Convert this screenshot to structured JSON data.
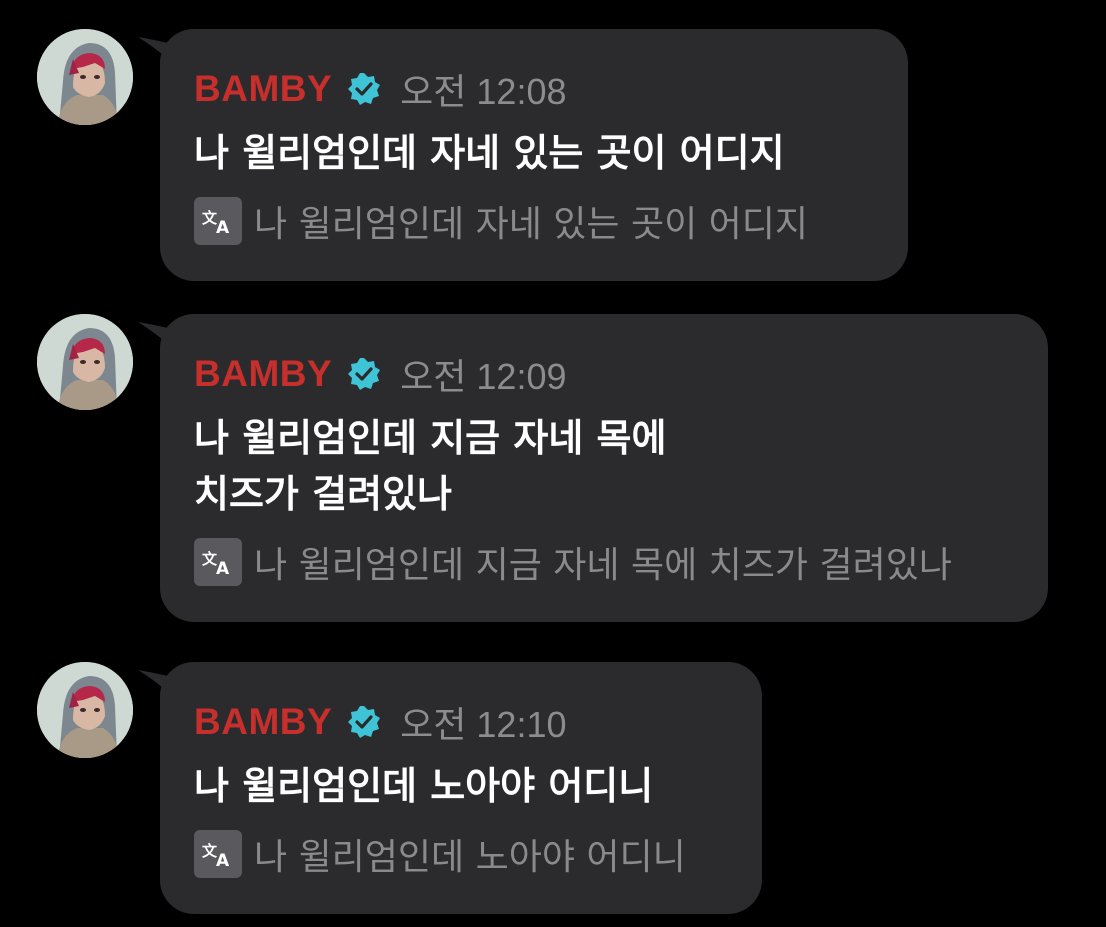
{
  "messages": [
    {
      "author": "BAMBY",
      "verified": true,
      "time": "오전 12:08",
      "text": "나 윌리엄인데 자네 있는 곳이 어디지",
      "translation": "나 윌리엄인데 자네 있는 곳이 어디지"
    },
    {
      "author": "BAMBY",
      "verified": true,
      "time": "오전 12:09",
      "text": "나 윌리엄인데 지금 자네 목에\n치즈가 걸려있나",
      "translation": "나 윌리엄인데 지금 자네 목에 치즈가 걸려있나"
    },
    {
      "author": "BAMBY",
      "verified": true,
      "time": "오전 12:10",
      "text": "나 윌리엄인데 노아야 어디니",
      "translation": "나 윌리엄인데 노아야 어디니"
    }
  ],
  "icons": {
    "avatar": "avatar-hooded-figure-icon",
    "verified": "verified-badge-icon",
    "translate": "translate-icon"
  },
  "colors": {
    "background": "#000000",
    "bubble": "#2b2b2d",
    "author": "#c62f2b",
    "verified": "#3ec4d6",
    "timestamp": "#8c8c90",
    "message_text": "#ffffff",
    "translation_text": "#8a8a8e"
  }
}
